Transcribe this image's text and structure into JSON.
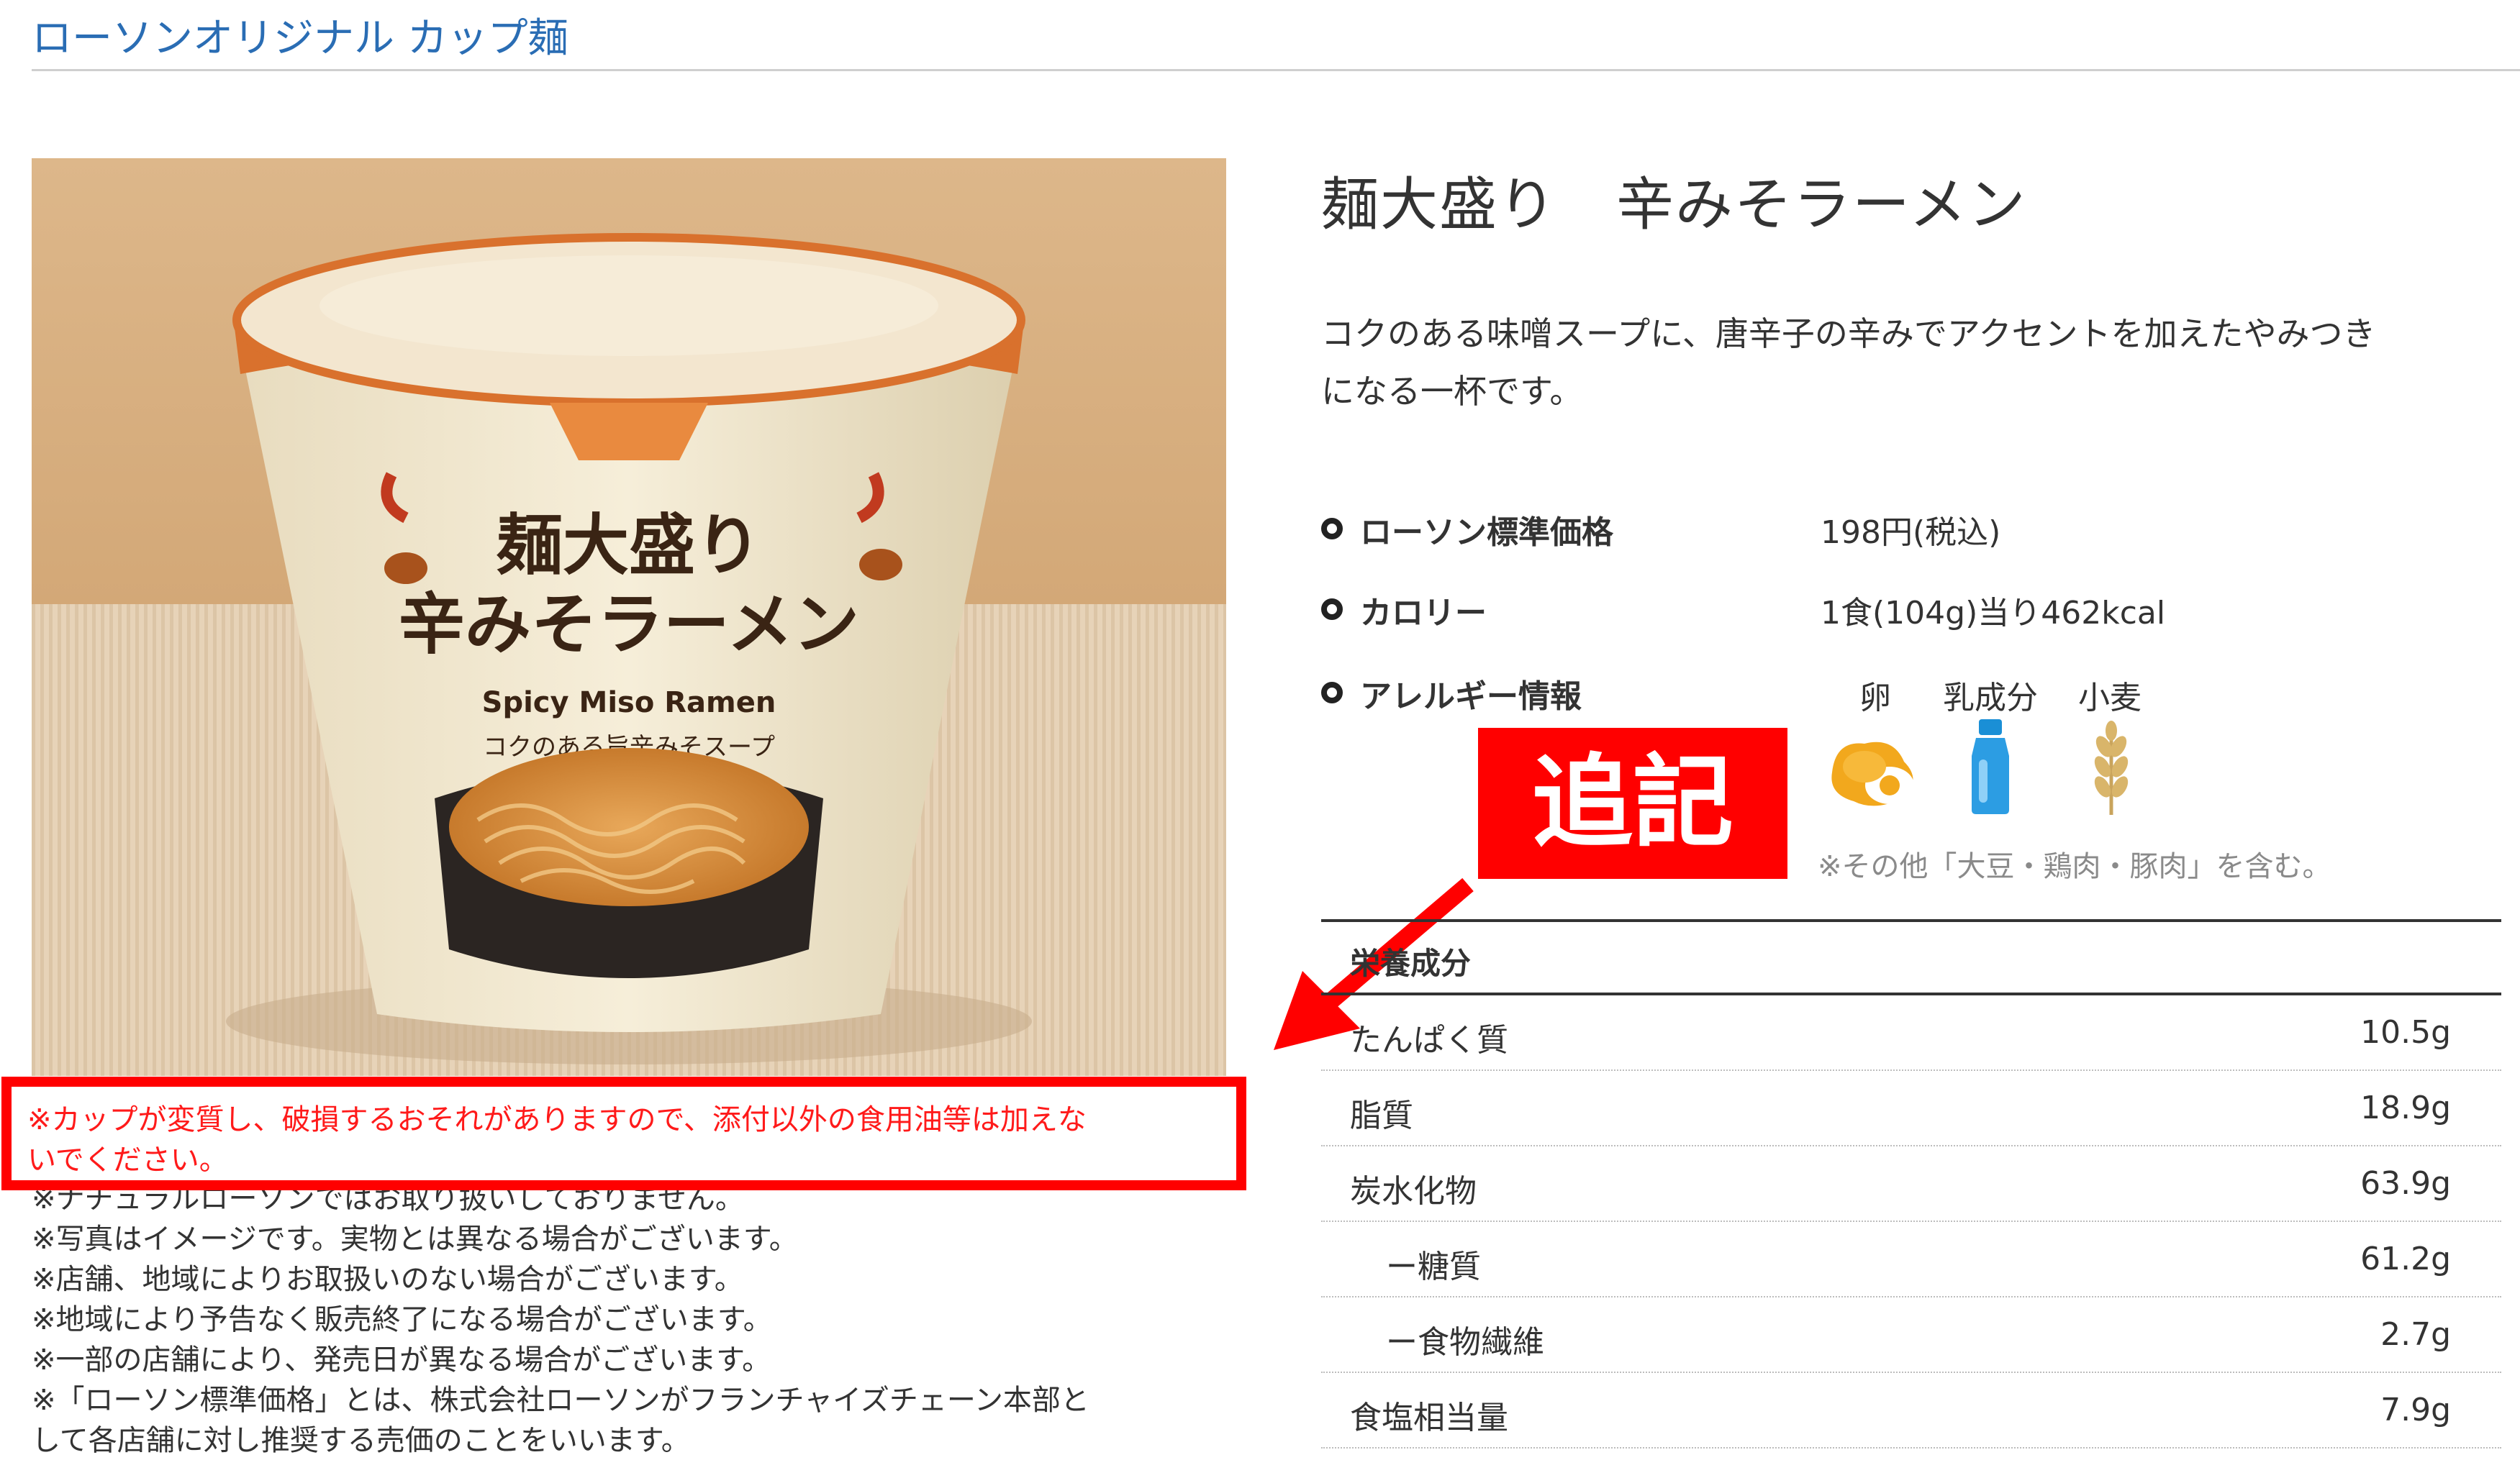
{
  "header": {
    "category_title": "ローソンオリジナル カップ麺"
  },
  "product": {
    "name": "麺大盛り　辛みそラーメン",
    "description_lines": [
      "コクのある味噌スープに、唐辛子の辛みでアクセントを加えたやみつき",
      "になる一杯です。"
    ],
    "image_package_text": {
      "name_line1": "麺大盛り",
      "name_line2": "辛みそラーメン",
      "english": "Spicy Miso Ramen",
      "tagline": "コクのある旨辛みそスープ"
    }
  },
  "specs": [
    {
      "label": "ローソン標準価格",
      "value": "198円(税込)"
    },
    {
      "label": "カロリー",
      "value": "1食(104g)当り462kcal"
    },
    {
      "label": "アレルギー情報",
      "value": ""
    }
  ],
  "allergens": {
    "items": [
      {
        "name": "卵",
        "icon": "egg-icon"
      },
      {
        "name": "乳成分",
        "icon": "milk-bottle-icon"
      },
      {
        "name": "小麦",
        "icon": "wheat-icon"
      }
    ],
    "note": "※その他「大豆・鶏肉・豚肉」を含む。"
  },
  "annotation": {
    "label": "追記",
    "color": "#ff0000"
  },
  "warning": {
    "lines": [
      "※カップが変質し、破損するおそれがありますので、添付以外の食用油等は加えな",
      "いでください。"
    ]
  },
  "notes": {
    "partial_line": "※ナチュラルローソンではお取り扱いしておりません。",
    "lines": [
      "※写真はイメージです。実物とは異なる場合がございます。",
      "※店舗、地域によりお取扱いのない場合がございます。",
      "※地域により予告なく販売終了になる場合がございます。",
      "※一部の店舗により、発売日が異なる場合がございます。",
      "※「ローソン標準価格」とは、株式会社ローソンがフランチャイズチェーン本部と",
      "して各店舗に対し推奨する売価のことをいいます。"
    ]
  },
  "nutrition": {
    "title": "栄養成分",
    "rows": [
      {
        "name": "たんぱく質",
        "value": "10.5g"
      },
      {
        "name": "脂質",
        "value": "18.9g"
      },
      {
        "name": "炭水化物",
        "value": "63.9g"
      },
      {
        "name": "ー糖質",
        "value": "61.2g"
      },
      {
        "name": "ー食物繊維",
        "value": "2.7g"
      },
      {
        "name": "食塩相当量",
        "value": "7.9g"
      }
    ]
  },
  "colors": {
    "link_blue": "#2a6db4",
    "text": "#333333",
    "highlight_red": "#ff0000"
  }
}
